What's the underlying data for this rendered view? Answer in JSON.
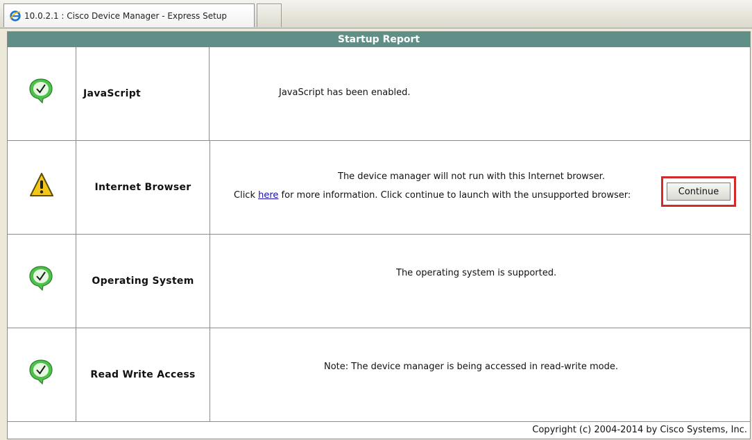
{
  "browser_tab": {
    "title": "10.0.2.1 : Cisco Device Manager - Express Setup",
    "icon": "ie-browser-icon"
  },
  "report": {
    "title": "Startup Report",
    "rows": [
      {
        "status_icon": "check-circle-icon",
        "name": "JavaScript",
        "message": "JavaScript has been enabled."
      },
      {
        "status_icon": "warning-icon",
        "name": "Internet Browser",
        "message_line1": "The device manager will not run with this Internet browser.",
        "message_line2_prefix": "Click ",
        "link_text": "here",
        "message_line2_suffix": " for more information. Click continue to launch with the unsupported browser:",
        "button_label": "Continue"
      },
      {
        "status_icon": "check-circle-icon",
        "name": "Operating System",
        "message": "The operating system is supported."
      },
      {
        "status_icon": "check-circle-icon",
        "name": "Read Write Access",
        "message": "Note: The device manager is being accessed in read-write mode."
      }
    ],
    "copyright": "Copyright (c) 2004-2014 by Cisco Systems, Inc."
  },
  "colors": {
    "header_bg": "#5f8f86",
    "check_green": "#4cc24a",
    "warning_yellow": "#f3c61a",
    "highlight_red": "#d22a2a"
  }
}
